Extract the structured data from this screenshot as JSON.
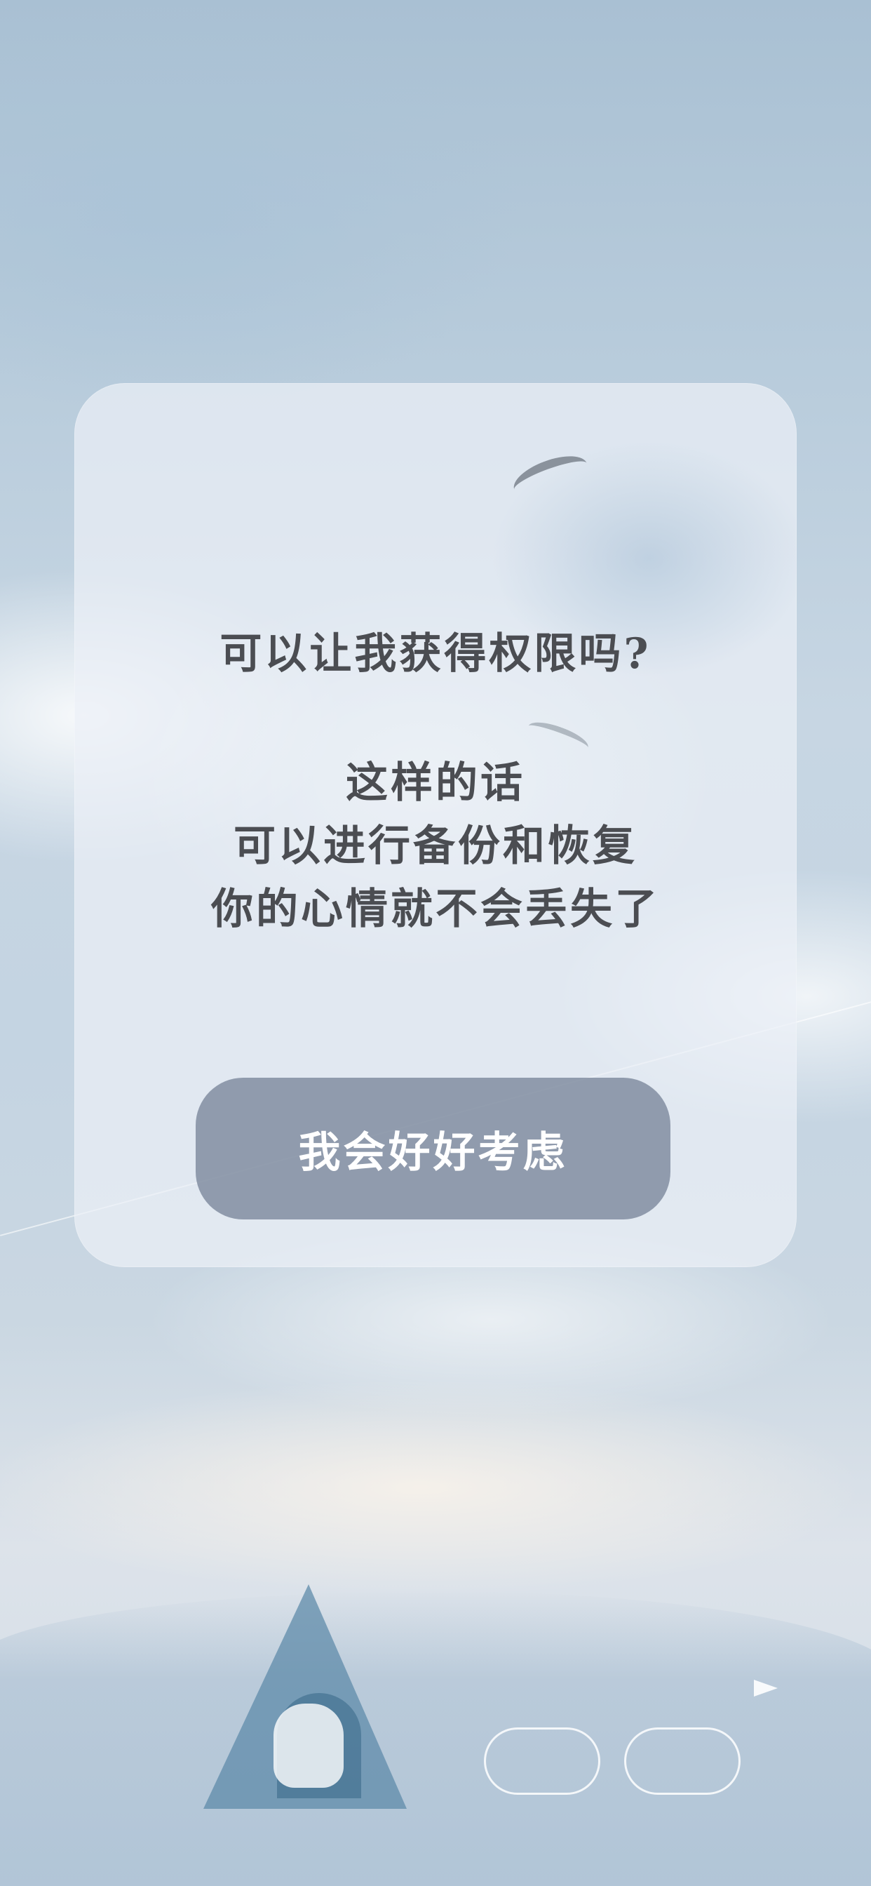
{
  "dialog": {
    "question": "可以让我获得权限吗?",
    "explain_lines": [
      "这样的话",
      "可以进行备份和恢复",
      "你的心情就不会丢失了"
    ],
    "button_label": "我会好好考虑"
  },
  "colors": {
    "text": "#4b4d52",
    "button_bg": "#78859a",
    "button_text": "#ffffff"
  }
}
